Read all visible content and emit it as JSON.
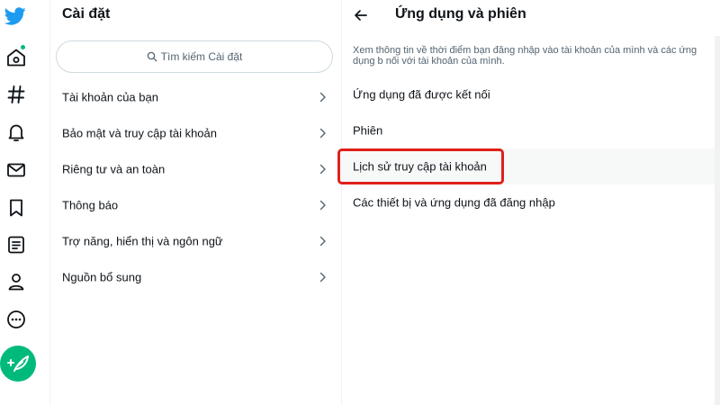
{
  "rail": {
    "icons": [
      "twitter-logo-icon",
      "home-icon",
      "explore-hashtag-icon",
      "notifications-bell-icon",
      "messages-mail-icon",
      "bookmark-icon",
      "lists-icon",
      "profile-icon",
      "more-circle-icon"
    ],
    "compose_icon": "compose-feather-icon",
    "brand_color": "#1d9bf0",
    "accent_color": "#00ba7c"
  },
  "settings": {
    "title": "Cài đặt",
    "search_placeholder": "Tìm kiếm Cài đặt",
    "items": [
      {
        "label": "Tài khoản của bạn"
      },
      {
        "label": "Bảo mật và truy cập tài khoản"
      },
      {
        "label": "Riêng tư và an toàn"
      },
      {
        "label": "Thông báo"
      },
      {
        "label": "Trợ năng, hiển thị và ngôn ngữ"
      },
      {
        "label": "Nguồn bổ sung"
      }
    ]
  },
  "detail": {
    "title": "Ứng dụng và phiên",
    "description": "Xem thông tin về thời điểm bạn đăng nhập vào tài khoản của mình và các ứng dụng b nối với tài khoản của mình.",
    "items": [
      {
        "label": "Ứng dụng đã được kết nối"
      },
      {
        "label": "Phiên"
      },
      {
        "label": "Lịch sử truy cập tài khoản"
      },
      {
        "label": "Các thiết bị và ứng dụng đã đăng nhập"
      }
    ],
    "highlighted_item": "Lịch sử truy cập tài khoản",
    "highlight_color": "#e0201b"
  }
}
